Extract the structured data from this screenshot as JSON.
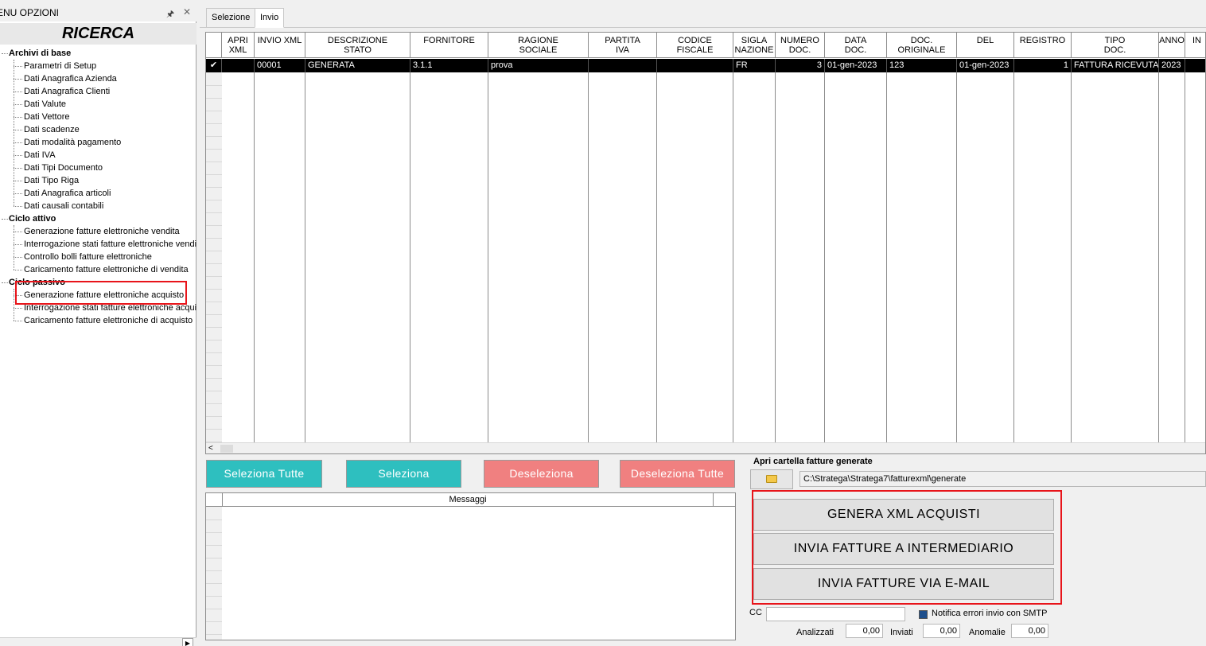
{
  "menu": {
    "title": "ENU OPZIONI",
    "pin_icon": "pin-icon",
    "close_icon": "close-icon",
    "search_title": "RICERCA",
    "groups": [
      {
        "label": "Archivi di base",
        "items": [
          "Parametri di Setup",
          "Dati Anagrafica Azienda",
          "Dati Anagrafica Clienti",
          "Dati Valute",
          "Dati Vettore",
          "Dati scadenze",
          "Dati modalità pagamento",
          "Dati IVA",
          "Dati Tipi Documento",
          "Dati Tipo Riga",
          "Dati Anagrafica articoli",
          "Dati causali contabili"
        ]
      },
      {
        "label": "Ciclo attivo",
        "items": [
          "Generazione fatture elettroniche vendita",
          "Interrogazione stati fatture elettroniche vendita",
          "Controllo bolli fatture elettroniche",
          "Caricamento fatture elettroniche di vendita"
        ]
      },
      {
        "label": "Ciclo passivo",
        "items": [
          "Generazione fatture elettroniche acquisto",
          "Interrogazione stati fatture elettroniche acquisto",
          "Caricamento fatture elettroniche di acquisto"
        ]
      }
    ]
  },
  "tabs": [
    {
      "label": "Selezione",
      "active": false
    },
    {
      "label": "Invio",
      "active": true
    }
  ],
  "grid": {
    "columns": [
      "APRI\nXML",
      "INVIO XML",
      "DESCRIZIONE\nSTATO",
      "FORNITORE",
      "RAGIONE\nSOCIALE",
      "PARTITA\nIVA",
      "CODICE\nFISCALE",
      "SIGLA\nNAZIONE",
      "NUMERO\nDOC.",
      "DATA\nDOC.",
      "DOC.\nORIGINALE",
      "DEL",
      "REGISTRO",
      "TIPO\nDOC.",
      "ANNO",
      "IN"
    ],
    "rows": [
      {
        "checked": true,
        "cells": [
          "",
          "00001",
          "GENERATA",
          "3.1.1",
          "prova",
          "",
          "",
          "FR",
          "3",
          "01-gen-2023",
          "123",
          "01-gen-2023",
          "1",
          "FATTURA RICEVUTA",
          "2023",
          ""
        ]
      }
    ]
  },
  "buttons": {
    "select_all": "Seleziona Tutte",
    "select": "Seleziona",
    "deselect": "Deseleziona",
    "deselect_all": "Deseleziona Tutte",
    "genera_xml": "GENERA XML ACQUISTI",
    "invia_intermediario": "INVIA FATTURE A INTERMEDIARIO",
    "invia_email": "INVIA FATTURE VIA E-MAIL"
  },
  "messages": {
    "header": "Messaggi"
  },
  "folder": {
    "label": "Apri cartella fatture generate",
    "path": "C:\\Stratega\\Stratega7\\fatturexml\\generate",
    "icon": "folder-icon"
  },
  "cc": {
    "label": "CC",
    "value": ""
  },
  "notify": {
    "label": "Notifica errori invio con SMTP",
    "checked": true
  },
  "stats": {
    "analizzati_label": "Analizzati",
    "analizzati_value": "0,00",
    "inviati_label": "Inviati",
    "inviati_value": "0,00",
    "anomalie_label": "Anomalie",
    "anomalie_value": "0,00"
  },
  "colors": {
    "teal_button": "#2ebfbf",
    "salmon_button": "#f08080",
    "highlight_red": "#e8141a",
    "selected_row": "#000000"
  }
}
